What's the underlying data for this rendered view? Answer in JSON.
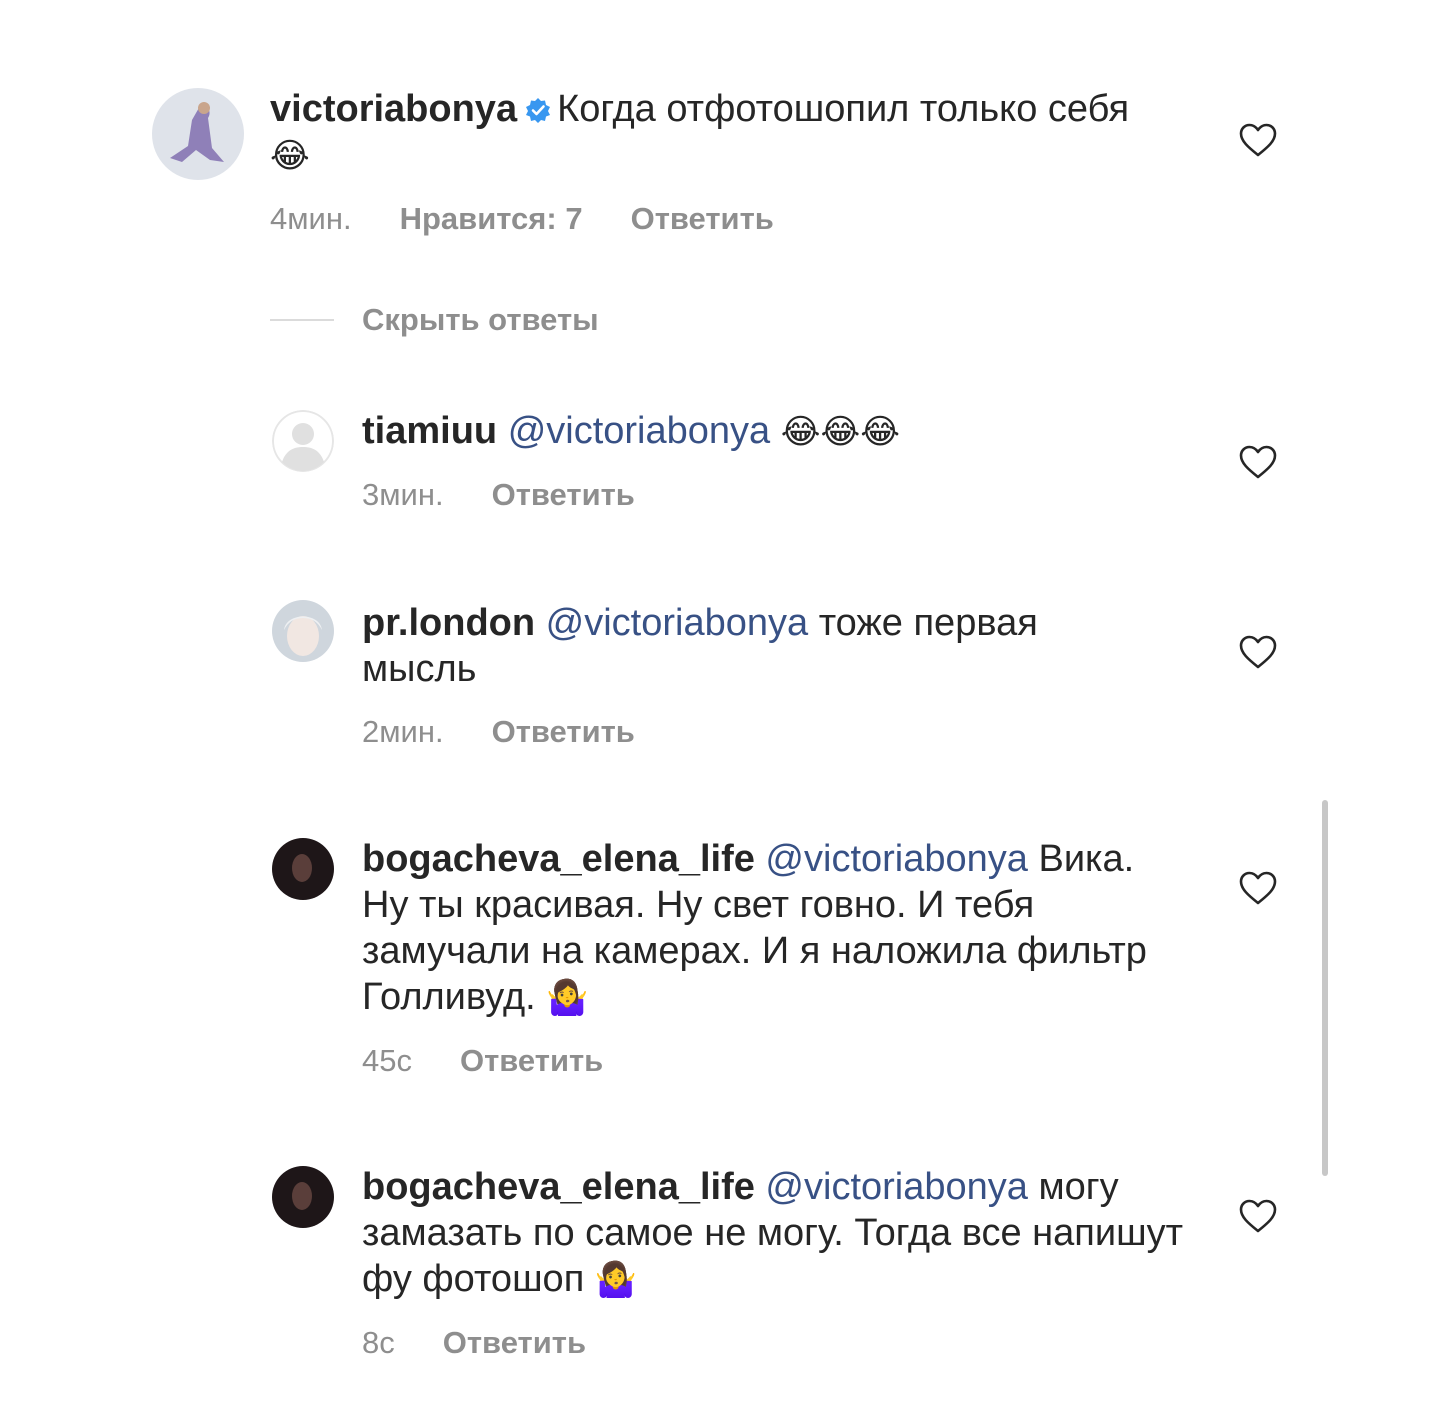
{
  "comments": [
    {
      "username": "victoriabonya",
      "verified": true,
      "mention": "",
      "text": "Когда отфотошопил только себя",
      "emoji": "😂",
      "time": "4мин.",
      "likes": "Нравится: 7",
      "reply": "Ответить"
    },
    {
      "username": "tiamiuu",
      "mention": "@victoriabonya",
      "text": "",
      "emoji": "😂😂😂",
      "time": "3мин.",
      "reply": "Ответить"
    },
    {
      "username": "pr.london",
      "mention": "@victoriabonya",
      "text": "тоже первая мысль",
      "emoji": "",
      "time": "2мин.",
      "reply": "Ответить"
    },
    {
      "username": "bogacheva_elena_life",
      "mention": "@victoriabonya",
      "text": "Вика. Ну ты красивая. Ну свет говно. И тебя замучали на камерах. И я наложила фильтр Голливуд.",
      "emoji": "🤷‍♀️",
      "time": "45с",
      "reply": "Ответить"
    },
    {
      "username": "bogacheva_elena_life",
      "mention": "@victoriabonya",
      "text": "могу замазать по самое не могу. Тогда все напишут фу фотошоп",
      "emoji": "🤷‍♀️",
      "time": "8с",
      "reply": "Ответить"
    }
  ],
  "hide_replies": "Скрыть ответы",
  "colors": {
    "text": "#262626",
    "meta": "#8e8e8e",
    "mention": "#385185",
    "verified": "#3897f0"
  }
}
